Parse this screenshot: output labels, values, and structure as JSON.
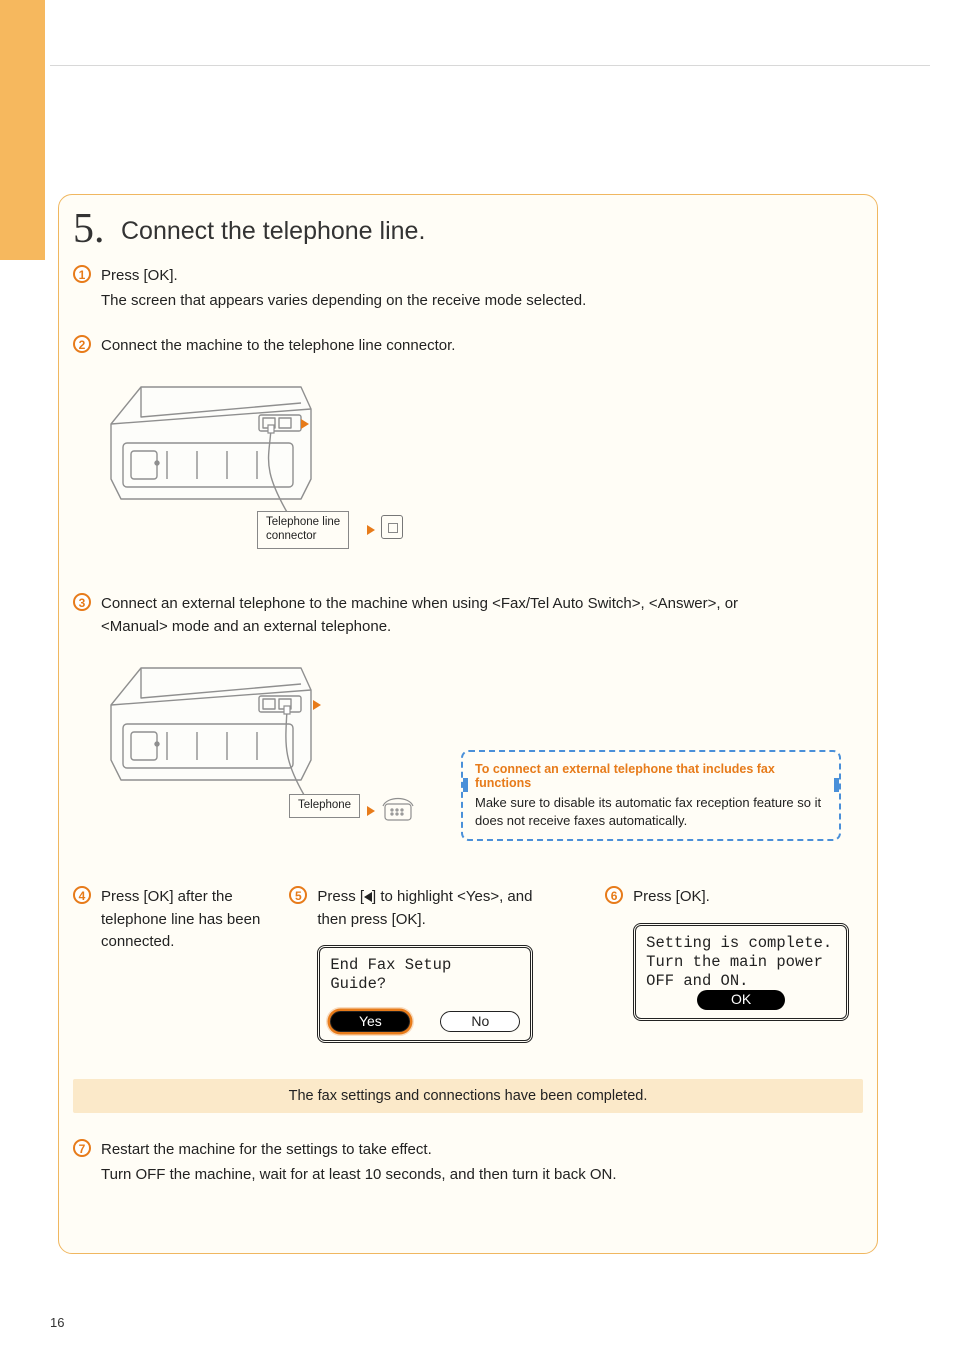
{
  "page_number": "16",
  "step": {
    "number": "5.",
    "title": "Connect the telephone line."
  },
  "sub": {
    "s1": {
      "n": "1",
      "text": "Press [OK].",
      "note": "The screen that appears varies depending on the receive mode selected."
    },
    "s2": {
      "n": "2",
      "text": "Connect the machine to the telephone line connector.",
      "label": "Telephone line\nconnector"
    },
    "s3": {
      "n": "3",
      "text": "Connect an external telephone to the machine when using <Fax/Tel Auto Switch>, <Answer>, or <Manual> mode and an external telephone.",
      "label": "Telephone"
    },
    "s4": {
      "n": "4",
      "text": "Press [OK] after the telephone line has been connected."
    },
    "s5": {
      "n": "5",
      "text_before": "Press [",
      "text_after": "] to highlight <Yes>, and then press [OK]."
    },
    "s6": {
      "n": "6",
      "text": "Press [OK]."
    },
    "s7": {
      "n": "7",
      "text": "Restart the machine for the settings to take effect.",
      "note": "Turn OFF the machine, wait for at least 10 seconds, and then turn it back ON."
    }
  },
  "callout": {
    "title": "To connect an external telephone that includes fax functions",
    "body": "Make sure to disable its automatic fax reception feature so it does not receive faxes automatically."
  },
  "lcd1": {
    "line1": "End Fax Setup",
    "line2": "Guide?",
    "yes": "Yes",
    "no": "No"
  },
  "lcd2": {
    "line1": "Setting is complete.",
    "line2": "Turn the main power",
    "line3": "OFF and ON.",
    "ok": "OK"
  },
  "completion": "The fax settings and connections have been completed."
}
